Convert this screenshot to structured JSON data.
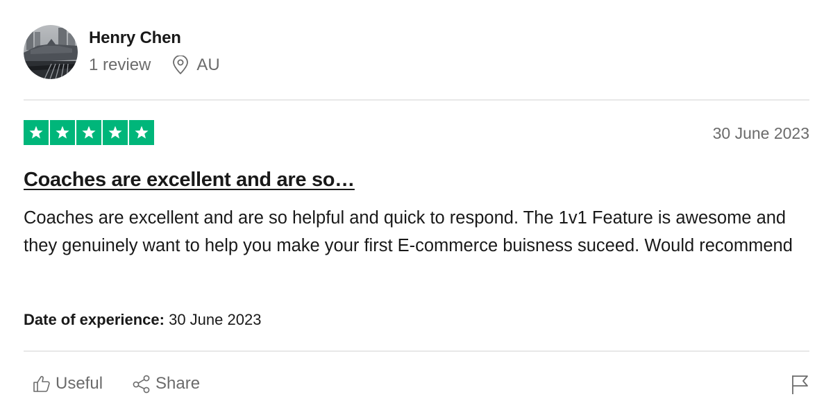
{
  "reviewer": {
    "name": "Henry Chen",
    "review_count": "1 review",
    "country": "AU",
    "avatar_icon": "avatar-photo",
    "location_icon": "location-pin-icon"
  },
  "rating": {
    "stars": 5,
    "max_stars": 5,
    "star_color": "#00b67a"
  },
  "review": {
    "date": "30 June 2023",
    "title": "Coaches are excellent and are so…",
    "text": "Coaches are excellent and are so helpful and quick to respond. The 1v1 Feature is awesome and they genuinely want to help you make your first E-commerce buisness suceed. Would recommend",
    "experience_label": "Date of experience:",
    "experience_date": "30 June 2023"
  },
  "actions": {
    "useful_label": "Useful",
    "share_label": "Share",
    "useful_icon": "thumbs-up-icon",
    "share_icon": "share-icon",
    "flag_icon": "flag-icon"
  },
  "colors": {
    "text": "#191919",
    "muted": "#6b6b6b",
    "divider": "#e8e8e8"
  }
}
